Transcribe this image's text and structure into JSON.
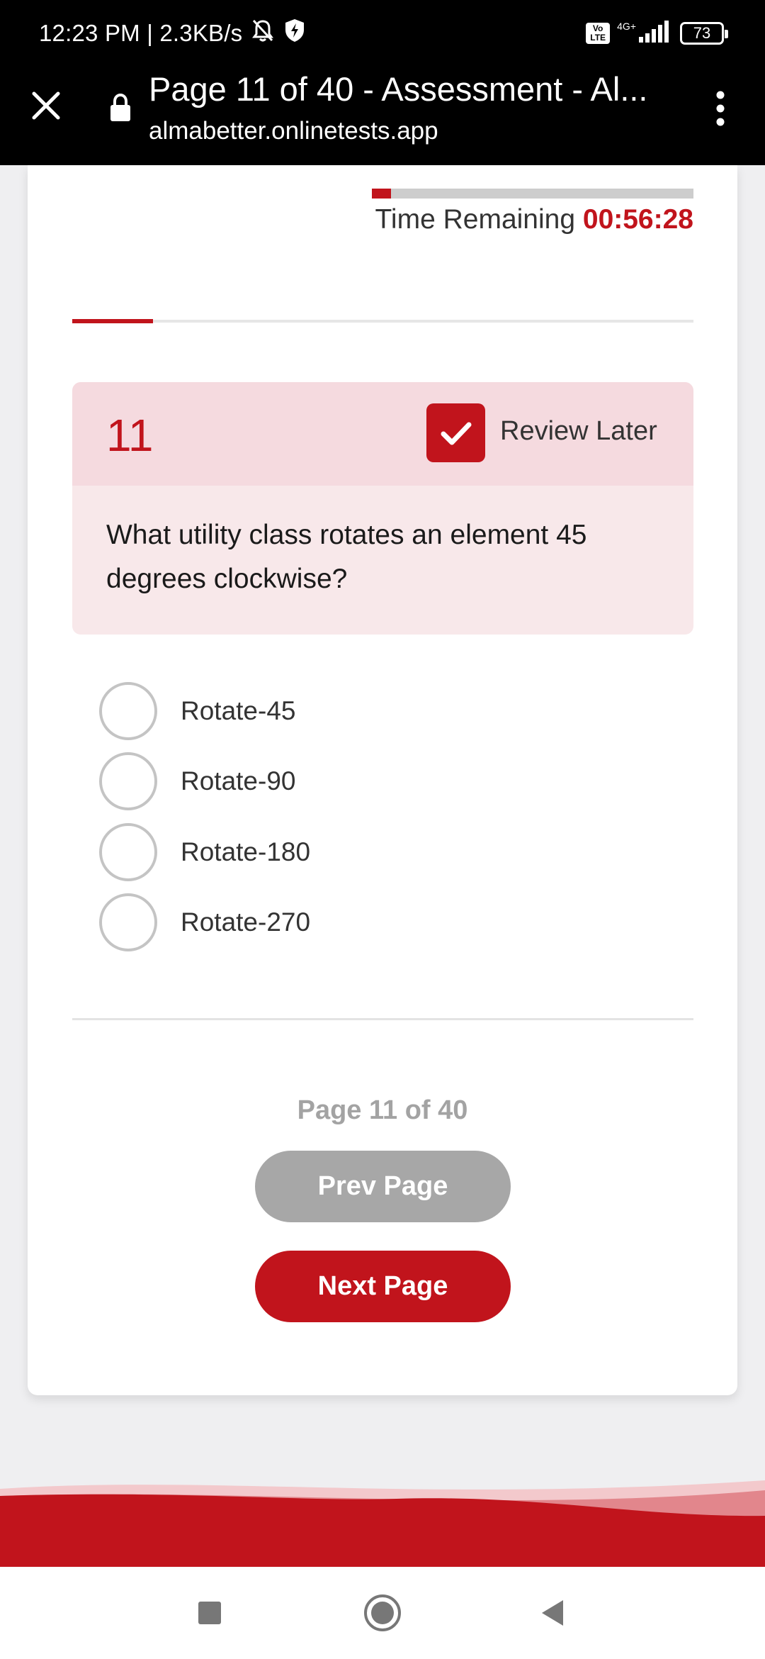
{
  "status_bar": {
    "time_speed": "12:23 PM | 2.3KB/s",
    "volte_line1": "Vo",
    "volte_line2": "LTE",
    "network_type": "4G+",
    "battery": "73"
  },
  "browser": {
    "title": "Page 11 of 40 - Assessment - Al...",
    "url": "almabetter.onlinetests.app"
  },
  "timer": {
    "label": "Time Remaining",
    "value": "00:56:28",
    "elapsed_fraction": 0.06
  },
  "progress": {
    "fraction": 0.13
  },
  "question": {
    "number": "11",
    "review_label": "Review Later",
    "review_checked": true,
    "text": "What utility class rotates an element 45 degrees clockwise?",
    "options": [
      {
        "label": "Rotate-45"
      },
      {
        "label": "Rotate-90"
      },
      {
        "label": "Rotate-180"
      },
      {
        "label": "Rotate-270"
      }
    ]
  },
  "pagination": {
    "indicator": "Page 11 of 40",
    "prev_label": "Prev Page",
    "next_label": "Next Page"
  },
  "colors": {
    "accent": "#c1141c",
    "question_header_bg": "#f5dadf",
    "question_body_bg": "#f8e8ea",
    "disabled_button": "#a7a7a7"
  },
  "icons": {
    "close": "close-icon",
    "lock": "lock-icon",
    "menu": "more-vert-icon",
    "check": "check-icon",
    "nav_recents": "square-icon",
    "nav_home": "circle-icon",
    "nav_back": "triangle-back-icon"
  }
}
